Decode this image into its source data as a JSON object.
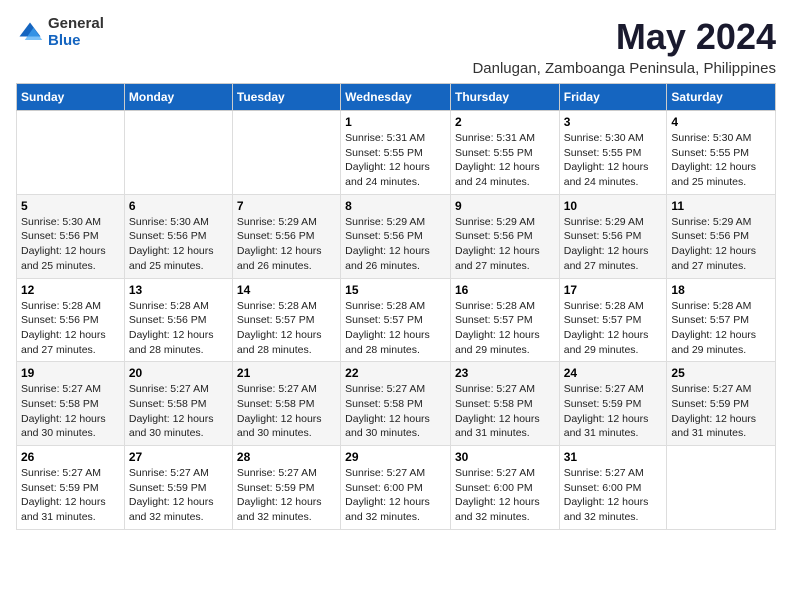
{
  "logo": {
    "general": "General",
    "blue": "Blue"
  },
  "title": "May 2024",
  "subtitle": "Danlugan, Zamboanga Peninsula, Philippines",
  "days_header": [
    "Sunday",
    "Monday",
    "Tuesday",
    "Wednesday",
    "Thursday",
    "Friday",
    "Saturday"
  ],
  "weeks": [
    [
      {
        "day": "",
        "sunrise": "",
        "sunset": "",
        "daylight": ""
      },
      {
        "day": "",
        "sunrise": "",
        "sunset": "",
        "daylight": ""
      },
      {
        "day": "",
        "sunrise": "",
        "sunset": "",
        "daylight": ""
      },
      {
        "day": "1",
        "sunrise": "Sunrise: 5:31 AM",
        "sunset": "Sunset: 5:55 PM",
        "daylight": "Daylight: 12 hours and 24 minutes."
      },
      {
        "day": "2",
        "sunrise": "Sunrise: 5:31 AM",
        "sunset": "Sunset: 5:55 PM",
        "daylight": "Daylight: 12 hours and 24 minutes."
      },
      {
        "day": "3",
        "sunrise": "Sunrise: 5:30 AM",
        "sunset": "Sunset: 5:55 PM",
        "daylight": "Daylight: 12 hours and 24 minutes."
      },
      {
        "day": "4",
        "sunrise": "Sunrise: 5:30 AM",
        "sunset": "Sunset: 5:55 PM",
        "daylight": "Daylight: 12 hours and 25 minutes."
      }
    ],
    [
      {
        "day": "5",
        "sunrise": "Sunrise: 5:30 AM",
        "sunset": "Sunset: 5:56 PM",
        "daylight": "Daylight: 12 hours and 25 minutes."
      },
      {
        "day": "6",
        "sunrise": "Sunrise: 5:30 AM",
        "sunset": "Sunset: 5:56 PM",
        "daylight": "Daylight: 12 hours and 25 minutes."
      },
      {
        "day": "7",
        "sunrise": "Sunrise: 5:29 AM",
        "sunset": "Sunset: 5:56 PM",
        "daylight": "Daylight: 12 hours and 26 minutes."
      },
      {
        "day": "8",
        "sunrise": "Sunrise: 5:29 AM",
        "sunset": "Sunset: 5:56 PM",
        "daylight": "Daylight: 12 hours and 26 minutes."
      },
      {
        "day": "9",
        "sunrise": "Sunrise: 5:29 AM",
        "sunset": "Sunset: 5:56 PM",
        "daylight": "Daylight: 12 hours and 27 minutes."
      },
      {
        "day": "10",
        "sunrise": "Sunrise: 5:29 AM",
        "sunset": "Sunset: 5:56 PM",
        "daylight": "Daylight: 12 hours and 27 minutes."
      },
      {
        "day": "11",
        "sunrise": "Sunrise: 5:29 AM",
        "sunset": "Sunset: 5:56 PM",
        "daylight": "Daylight: 12 hours and 27 minutes."
      }
    ],
    [
      {
        "day": "12",
        "sunrise": "Sunrise: 5:28 AM",
        "sunset": "Sunset: 5:56 PM",
        "daylight": "Daylight: 12 hours and 27 minutes."
      },
      {
        "day": "13",
        "sunrise": "Sunrise: 5:28 AM",
        "sunset": "Sunset: 5:56 PM",
        "daylight": "Daylight: 12 hours and 28 minutes."
      },
      {
        "day": "14",
        "sunrise": "Sunrise: 5:28 AM",
        "sunset": "Sunset: 5:57 PM",
        "daylight": "Daylight: 12 hours and 28 minutes."
      },
      {
        "day": "15",
        "sunrise": "Sunrise: 5:28 AM",
        "sunset": "Sunset: 5:57 PM",
        "daylight": "Daylight: 12 hours and 28 minutes."
      },
      {
        "day": "16",
        "sunrise": "Sunrise: 5:28 AM",
        "sunset": "Sunset: 5:57 PM",
        "daylight": "Daylight: 12 hours and 29 minutes."
      },
      {
        "day": "17",
        "sunrise": "Sunrise: 5:28 AM",
        "sunset": "Sunset: 5:57 PM",
        "daylight": "Daylight: 12 hours and 29 minutes."
      },
      {
        "day": "18",
        "sunrise": "Sunrise: 5:28 AM",
        "sunset": "Sunset: 5:57 PM",
        "daylight": "Daylight: 12 hours and 29 minutes."
      }
    ],
    [
      {
        "day": "19",
        "sunrise": "Sunrise: 5:27 AM",
        "sunset": "Sunset: 5:58 PM",
        "daylight": "Daylight: 12 hours and 30 minutes."
      },
      {
        "day": "20",
        "sunrise": "Sunrise: 5:27 AM",
        "sunset": "Sunset: 5:58 PM",
        "daylight": "Daylight: 12 hours and 30 minutes."
      },
      {
        "day": "21",
        "sunrise": "Sunrise: 5:27 AM",
        "sunset": "Sunset: 5:58 PM",
        "daylight": "Daylight: 12 hours and 30 minutes."
      },
      {
        "day": "22",
        "sunrise": "Sunrise: 5:27 AM",
        "sunset": "Sunset: 5:58 PM",
        "daylight": "Daylight: 12 hours and 30 minutes."
      },
      {
        "day": "23",
        "sunrise": "Sunrise: 5:27 AM",
        "sunset": "Sunset: 5:58 PM",
        "daylight": "Daylight: 12 hours and 31 minutes."
      },
      {
        "day": "24",
        "sunrise": "Sunrise: 5:27 AM",
        "sunset": "Sunset: 5:59 PM",
        "daylight": "Daylight: 12 hours and 31 minutes."
      },
      {
        "day": "25",
        "sunrise": "Sunrise: 5:27 AM",
        "sunset": "Sunset: 5:59 PM",
        "daylight": "Daylight: 12 hours and 31 minutes."
      }
    ],
    [
      {
        "day": "26",
        "sunrise": "Sunrise: 5:27 AM",
        "sunset": "Sunset: 5:59 PM",
        "daylight": "Daylight: 12 hours and 31 minutes."
      },
      {
        "day": "27",
        "sunrise": "Sunrise: 5:27 AM",
        "sunset": "Sunset: 5:59 PM",
        "daylight": "Daylight: 12 hours and 32 minutes."
      },
      {
        "day": "28",
        "sunrise": "Sunrise: 5:27 AM",
        "sunset": "Sunset: 5:59 PM",
        "daylight": "Daylight: 12 hours and 32 minutes."
      },
      {
        "day": "29",
        "sunrise": "Sunrise: 5:27 AM",
        "sunset": "Sunset: 6:00 PM",
        "daylight": "Daylight: 12 hours and 32 minutes."
      },
      {
        "day": "30",
        "sunrise": "Sunrise: 5:27 AM",
        "sunset": "Sunset: 6:00 PM",
        "daylight": "Daylight: 12 hours and 32 minutes."
      },
      {
        "day": "31",
        "sunrise": "Sunrise: 5:27 AM",
        "sunset": "Sunset: 6:00 PM",
        "daylight": "Daylight: 12 hours and 32 minutes."
      },
      {
        "day": "",
        "sunrise": "",
        "sunset": "",
        "daylight": ""
      }
    ]
  ]
}
